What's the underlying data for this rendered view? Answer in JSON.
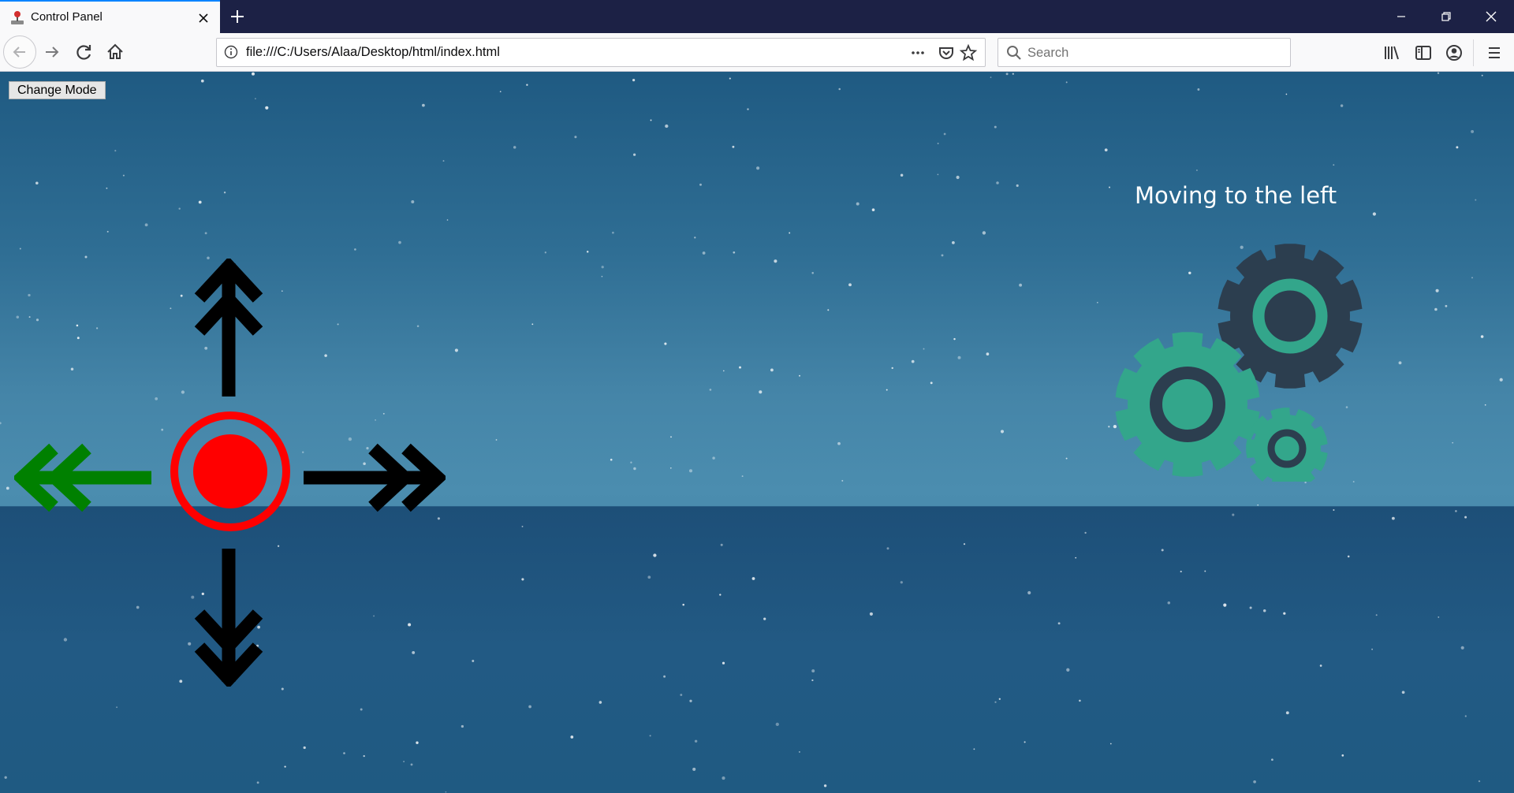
{
  "browser": {
    "tab": {
      "title": "Control Panel",
      "favicon": "joystick-icon"
    },
    "new_tab_icon": "plus-icon",
    "window_controls": [
      "minimize-icon",
      "restore-icon",
      "close-icon"
    ],
    "address_bar": {
      "url": "file:///C:/Users/Alaa/Desktop/html/index.html",
      "icons": [
        "info-icon",
        "more-icon",
        "pocket-icon",
        "bookmark-star-icon"
      ]
    },
    "search_bar": {
      "placeholder": "Search"
    },
    "toolbar_icons": [
      "library-icon",
      "sidebar-icon",
      "account-icon",
      "menu-icon"
    ]
  },
  "page": {
    "change_mode_label": "Change Mode",
    "status_text": "Moving to the left",
    "controls": {
      "active_direction": "left",
      "active_color": "#008000",
      "inactive_color": "#000000",
      "stop_button_color": "#ff0000",
      "buttons": [
        "up-arrow",
        "down-arrow",
        "left-arrow",
        "right-arrow",
        "stop-button"
      ]
    },
    "gears_colors": {
      "teal": "#33a68b",
      "dark": "#2c3e4f"
    }
  }
}
